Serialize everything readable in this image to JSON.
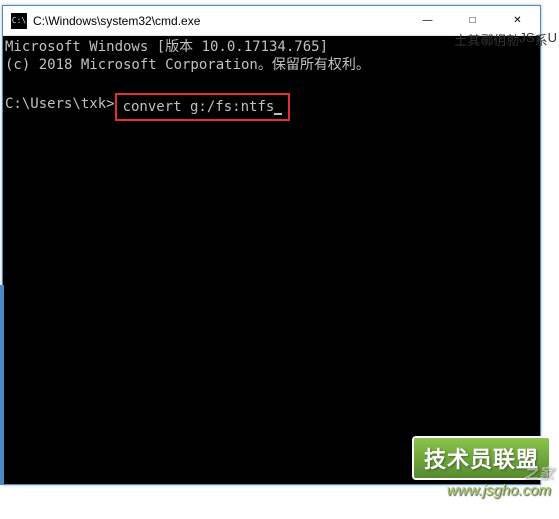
{
  "window": {
    "title": "C:\\Windows\\system32\\cmd.exe",
    "icon_label": "C:\\"
  },
  "console": {
    "line1": "Microsoft Windows [版本 10.0.17134.765]",
    "line2": "(c) 2018 Microsoft Corporation。保留所有权利。",
    "prompt": "C:\\Users\\txk>",
    "command": "convert g:/fs:ntfs"
  },
  "titlebar_buttons": {
    "minimize": "—",
    "maximize": "□",
    "close": "✕"
  },
  "side_fragments": [
    "U",
    "系",
    "JS",
    "勍",
    "仴",
    "鄩",
    "其",
    "土"
  ],
  "watermark": {
    "text": "技术员联盟",
    "overlay": "之家",
    "url": "www.jsgho.com"
  }
}
